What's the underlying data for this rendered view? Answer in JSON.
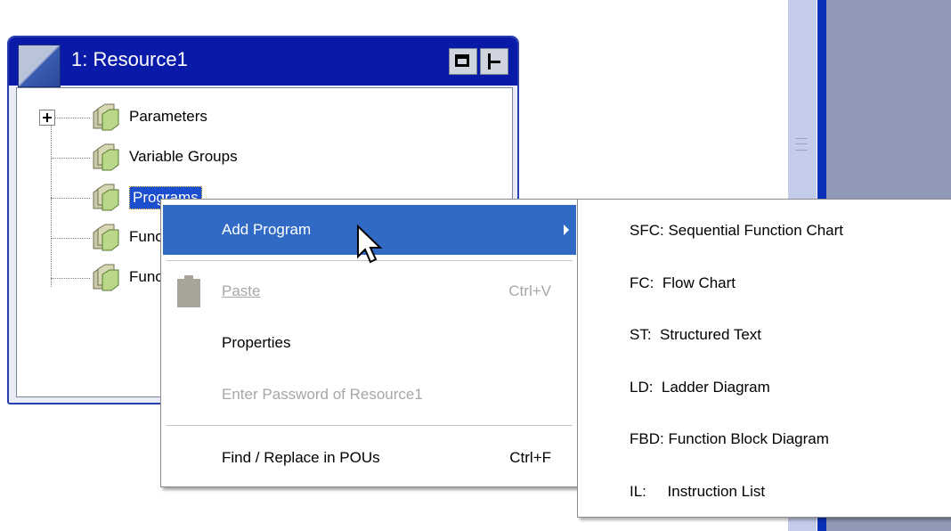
{
  "window": {
    "title": "1: Resource1"
  },
  "tree": {
    "items": [
      {
        "label": "Parameters"
      },
      {
        "label": "Variable Groups"
      },
      {
        "label": "Programs"
      },
      {
        "label": "Function Blocks"
      },
      {
        "label": "Functions"
      }
    ]
  },
  "context_menu": {
    "add_program": "Add Program",
    "paste": "Paste",
    "paste_shortcut": "Ctrl+V",
    "properties": "Properties",
    "enter_password": "Enter Password of Resource1",
    "find_replace": "Find / Replace in POUs",
    "find_replace_shortcut": "Ctrl+F"
  },
  "submenu": {
    "items": [
      {
        "label": "SFC: Sequential Function Chart"
      },
      {
        "label": "FC:  Flow Chart"
      },
      {
        "label": "ST:  Structured Text"
      },
      {
        "label": "LD:  Ladder Diagram"
      },
      {
        "label": "FBD: Function Block Diagram"
      },
      {
        "label": "IL:     Instruction List"
      }
    ]
  },
  "colors": {
    "title_bar": "#0a1aa8",
    "menu_highlight": "#316ac5",
    "disabled_text": "#a7a7a7"
  }
}
